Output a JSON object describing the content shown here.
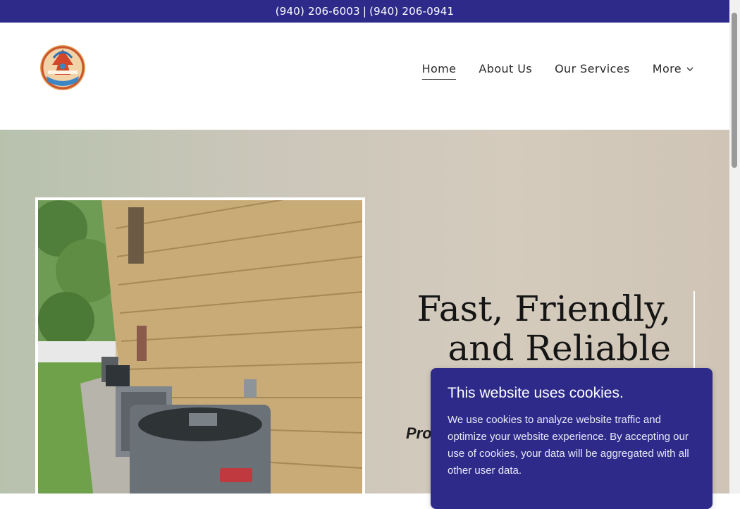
{
  "topbar": {
    "phone_1": "(940) 206-6003",
    "separator": "|",
    "phone_2": "(940) 206-0941",
    "background": "#2d2a8a"
  },
  "header": {
    "logo_icon": "company-logo-icon",
    "nav": {
      "home": "Home",
      "about": "About Us",
      "services": "Our Services",
      "more": "More",
      "more_icon": "chevron-down-icon"
    }
  },
  "hero": {
    "headline_line1": "Fast, Friendly,",
    "headline_line2": "and Reliable",
    "tagline": "Prof",
    "photo_icon": "ac-units-photo"
  },
  "cookie_banner": {
    "title": "This website uses cookies.",
    "body": "We use cookies to analyze website traffic and optimize your website experience. By accepting our use of cookies, your data will be aggregated with all other user data.",
    "background": "#2d2a8a"
  }
}
